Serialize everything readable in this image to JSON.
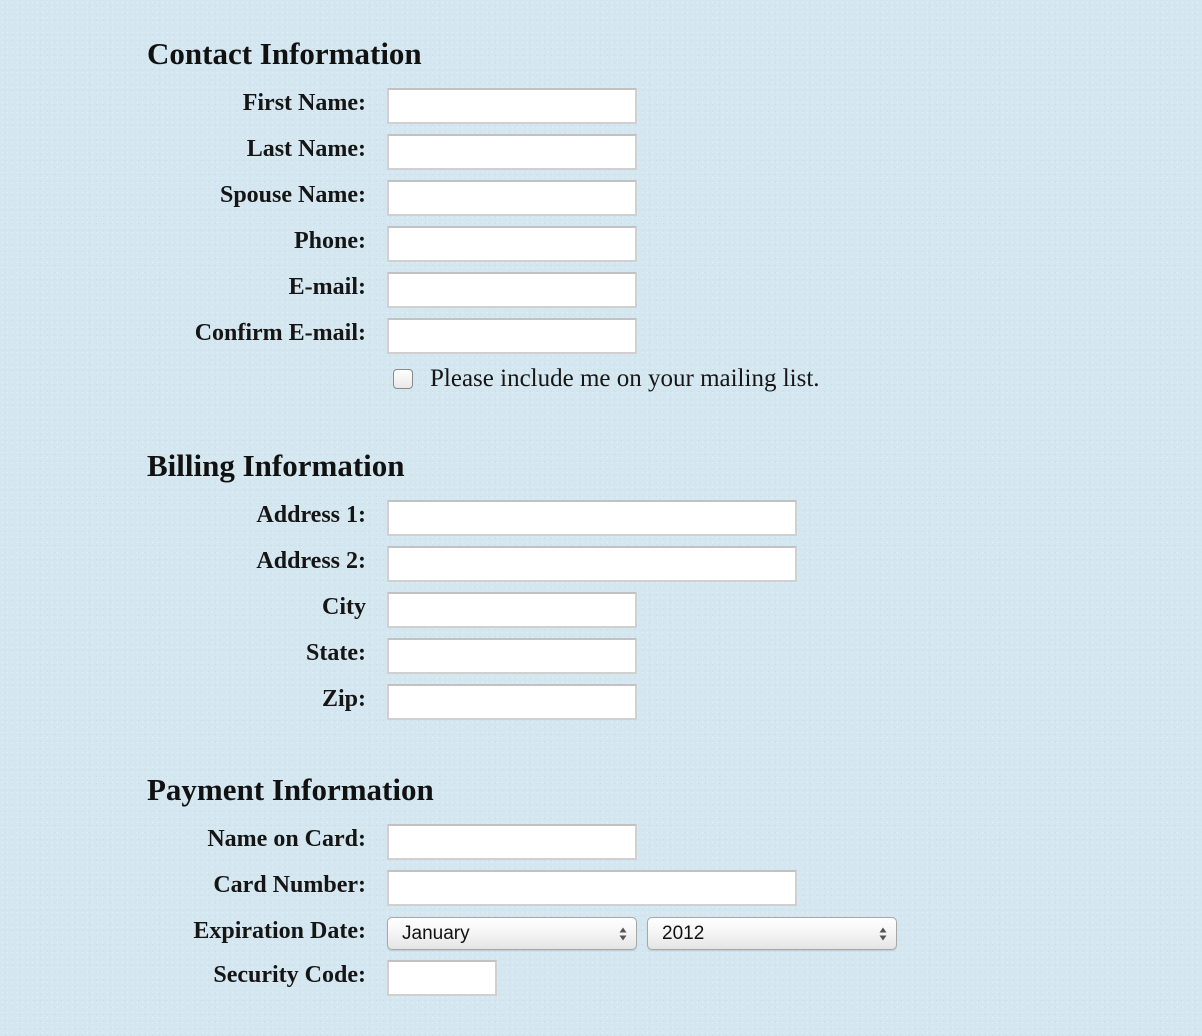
{
  "contact": {
    "title": "Contact Information",
    "fields": [
      {
        "label": "First Name:",
        "value": ""
      },
      {
        "label": "Last Name:",
        "value": ""
      },
      {
        "label": "Spouse Name:",
        "value": ""
      },
      {
        "label": "Phone:",
        "value": ""
      },
      {
        "label": "E-mail:",
        "value": ""
      },
      {
        "label": "Confirm E-mail:",
        "value": ""
      }
    ],
    "mailing_list": {
      "label": "Please include me on your mailing list.",
      "checked": false
    }
  },
  "billing": {
    "title": "Billing Information",
    "fields": [
      {
        "label": "Address 1:",
        "value": ""
      },
      {
        "label": "Address 2:",
        "value": ""
      },
      {
        "label": "City",
        "value": ""
      },
      {
        "label": "State:",
        "value": ""
      },
      {
        "label": "Zip:",
        "value": ""
      }
    ]
  },
  "payment": {
    "title": "Payment Information",
    "fields": [
      {
        "label": "Name on Card:",
        "value": ""
      },
      {
        "label": "Card Number:",
        "value": ""
      },
      {
        "label": "Expiration Date:"
      },
      {
        "label": "Security Code:",
        "value": ""
      }
    ],
    "expiration_month": "January",
    "expiration_year": "2012"
  }
}
